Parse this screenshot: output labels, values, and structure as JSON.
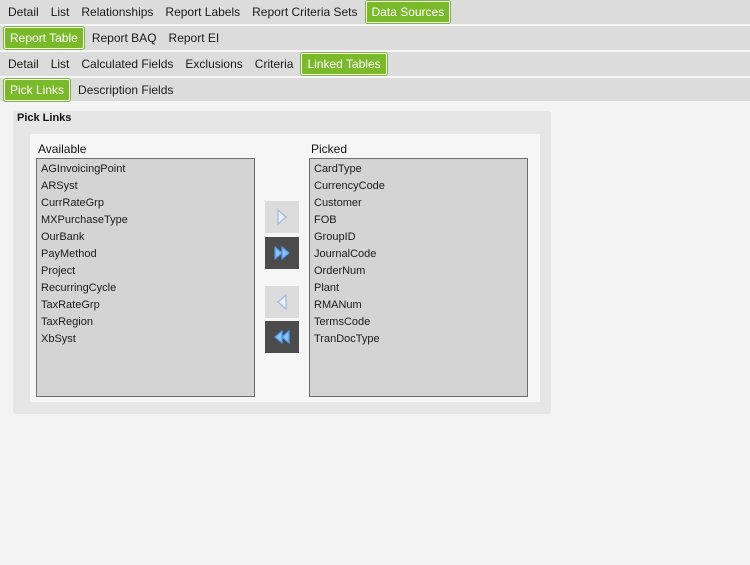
{
  "tabs_row1": [
    "Detail",
    "List",
    "Relationships",
    "Report Labels",
    "Report Criteria Sets",
    "Data Sources"
  ],
  "tabs_row1_active": 5,
  "tabs_row2": [
    "Report Table",
    "Report BAQ",
    "Report EI"
  ],
  "tabs_row2_active": 0,
  "tabs_row3": [
    "Detail",
    "List",
    "Calculated Fields",
    "Exclusions",
    "Criteria",
    "Linked Tables"
  ],
  "tabs_row3_active": 5,
  "tabs_row4": [
    "Pick Links",
    "Description Fields"
  ],
  "tabs_row4_active": 0,
  "panel": {
    "title": "Pick Links",
    "available_label": "Available",
    "picked_label": "Picked",
    "available": [
      "AGInvoicingPoint",
      "ARSyst",
      "CurrRateGrp",
      "MXPurchaseType",
      "OurBank",
      "PayMethod",
      "Project",
      "RecurringCycle",
      "TaxRateGrp",
      "TaxRegion",
      "XbSyst"
    ],
    "picked": [
      "CardType",
      "CurrencyCode",
      "Customer",
      "FOB",
      "GroupID",
      "JournalCode",
      "OrderNum",
      "Plant",
      "RMANum",
      "TermsCode",
      "TranDocType"
    ]
  },
  "buttons": {
    "move_right_icon": "arrow-right-icon",
    "move_all_right_icon": "double-arrow-right-icon",
    "move_left_icon": "arrow-left-icon",
    "move_all_left_icon": "double-arrow-left-icon"
  },
  "colors": {
    "active_tab": "#7ab929",
    "tab_bar": "#dcdcdc",
    "arrow_light": "#a9c4ea",
    "arrow_bright": "#4e9bf0"
  }
}
